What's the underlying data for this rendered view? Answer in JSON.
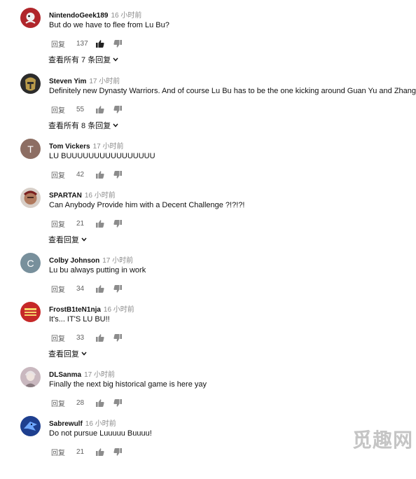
{
  "ui": {
    "reply_label": "回复",
    "colors": {
      "author": "#111111",
      "time": "#8a8a8a",
      "meta": "#606060"
    }
  },
  "comments": [
    {
      "author": "NintendoGeek189",
      "time": "16 小时前",
      "text": "But do we have to flee from Lu Bu?",
      "likes": "137",
      "view_replies": "查看所有 7 条回复",
      "avatar": {
        "icon": "nintendogeek-avatar",
        "color": "#b0262b"
      }
    },
    {
      "author": "Steven Yim",
      "time": "17 小时前",
      "text": "Definitely new Dynasty Warriors. And of course Lu Bu has to be the one kicking around Guan Yu and Zhang Fei.",
      "likes": "55",
      "view_replies": "查看所有 8 条回复",
      "avatar": {
        "icon": "helmet-avatar",
        "color": "#2b2b2b"
      }
    },
    {
      "author": "Tom Vickers",
      "time": "17 小时前",
      "text": "LU BUUUUUUUUUUUUUUUU",
      "likes": "42",
      "view_replies": "",
      "avatar": {
        "letter": "T",
        "color": "#8d6e63"
      }
    },
    {
      "author": "SPARTAN",
      "time": "16 小时前",
      "text": "Can Anybody Provide him with a Decent Challenge ?!?!?!",
      "likes": "21",
      "view_replies": "查看回复",
      "avatar": {
        "icon": "spartan-avatar",
        "color": "#b0795d"
      }
    },
    {
      "author": "Colby Johnson",
      "time": "17 小时前",
      "text": "Lu bu always putting in work",
      "likes": "34",
      "view_replies": "",
      "avatar": {
        "letter": "C",
        "color": "#78909c"
      }
    },
    {
      "author": "FrostB1teN1nja",
      "time": "16 小时前",
      "text": "It's... IT'S LU BU!!",
      "likes": "33",
      "view_replies": "查看回复",
      "avatar": {
        "icon": "emblem-avatar",
        "color": "#c62828"
      }
    },
    {
      "author": "DLSanma",
      "time": "17 小时前",
      "text": "Finally the next big historical game is here yay",
      "likes": "28",
      "view_replies": "",
      "avatar": {
        "icon": "portrait-avatar",
        "color": "#c9b8bf"
      }
    },
    {
      "author": "Sabrewulf",
      "time": "16 小时前",
      "text": "Do not pursue Luuuuu Buuuu!",
      "likes": "21",
      "view_replies": "",
      "avatar": {
        "icon": "wolf-avatar",
        "color": "#1e3f8f"
      }
    }
  ],
  "watermark": "觅趣网"
}
